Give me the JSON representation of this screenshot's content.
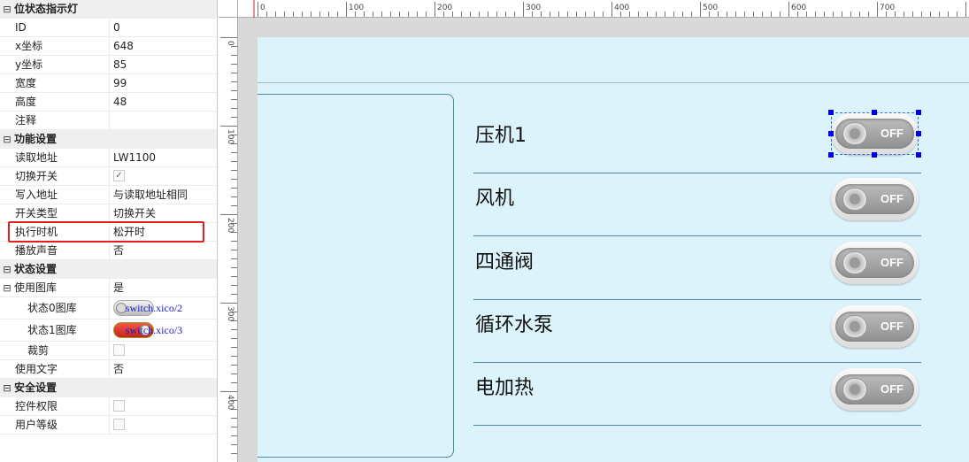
{
  "properties": {
    "sections": [
      {
        "title": "位状态指示灯",
        "rows": [
          {
            "key": "ID",
            "value": "0"
          },
          {
            "key": "x坐标",
            "value": "648"
          },
          {
            "key": "y坐标",
            "value": "85"
          },
          {
            "key": "宽度",
            "value": "99"
          },
          {
            "key": "高度",
            "value": "48"
          },
          {
            "key": "注释",
            "value": ""
          }
        ]
      },
      {
        "title": "功能设置",
        "rows": [
          {
            "key": "读取地址",
            "value": "LW1100"
          },
          {
            "key": "切换开关",
            "value": "✓"
          },
          {
            "key": "写入地址",
            "value": "与读取地址相同"
          },
          {
            "key": "开关类型",
            "value": "切换开关"
          },
          {
            "key": "执行时机",
            "value": "松开时"
          },
          {
            "key": "播放声音",
            "value": "否"
          }
        ]
      },
      {
        "title": "状态设置",
        "rows": [
          {
            "key": "使用图库",
            "value": "是"
          },
          {
            "key": "状态0图库",
            "value": "switch.xico/2"
          },
          {
            "key": "状态1图库",
            "value": "switch.xico/3"
          },
          {
            "key": "裁剪",
            "value": ""
          },
          {
            "key": "使用文字",
            "value": "否"
          }
        ]
      },
      {
        "title": "安全设置",
        "rows": [
          {
            "key": "控件权限",
            "value": ""
          },
          {
            "key": "用户等级",
            "value": ""
          }
        ]
      }
    ],
    "collapse_glyph": "⊟",
    "highlight_color": "#e02020"
  },
  "ruler": {
    "top_labels": [
      "0",
      "100",
      "200",
      "300",
      "400",
      "500",
      "600",
      "700"
    ],
    "left_labels": [
      "0",
      "100",
      "200",
      "300",
      "400"
    ]
  },
  "screen": {
    "background": "#dcf3fb",
    "items": [
      {
        "label": "压机1",
        "switch_text": "OFF"
      },
      {
        "label": "风机",
        "switch_text": "OFF"
      },
      {
        "label": "四通阀",
        "switch_text": "OFF"
      },
      {
        "label": "循环水泵",
        "switch_text": "OFF"
      },
      {
        "label": "电加热",
        "switch_text": "OFF"
      }
    ]
  }
}
